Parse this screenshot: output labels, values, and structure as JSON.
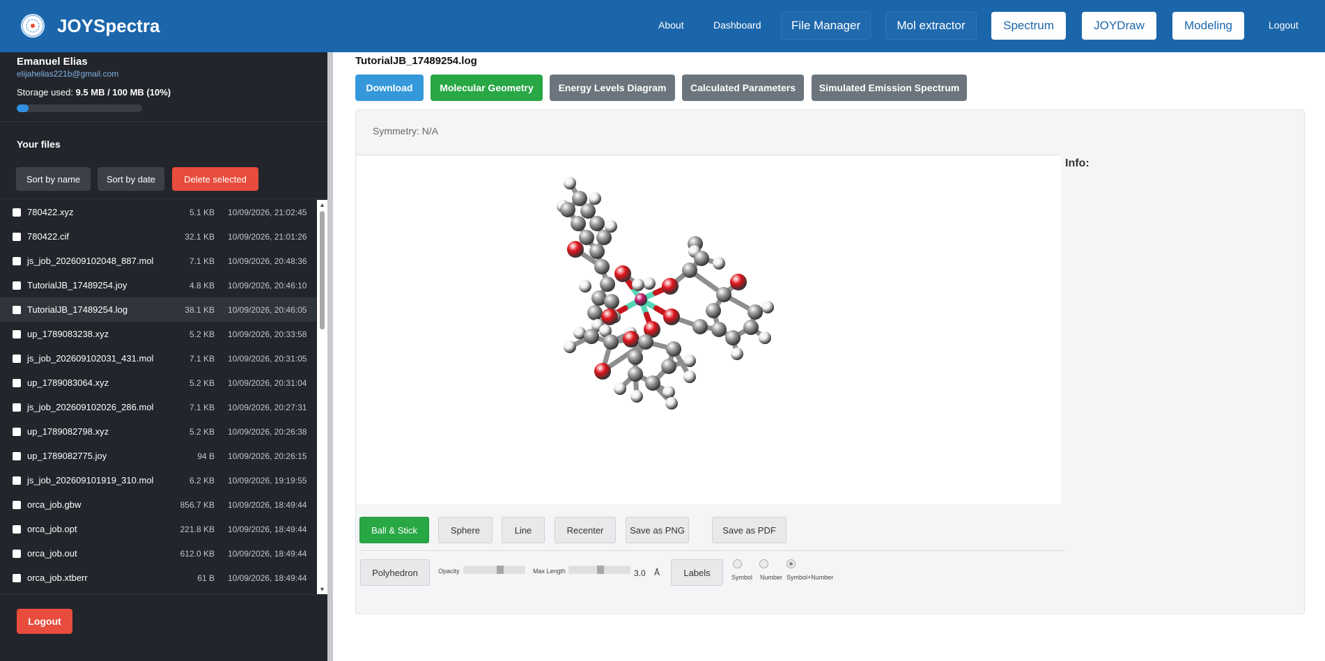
{
  "brand": {
    "name": "JOYSpectra",
    "logo_icon": "logo-icon"
  },
  "nav": {
    "about": "About",
    "dashboard": "Dashboard",
    "file_manager": "File Manager",
    "mol_extractor": "Mol extractor",
    "spectrum": "Spectrum",
    "joydraw": "JOYDraw",
    "modeling": "Modeling",
    "logout": "Logout"
  },
  "user": {
    "name": "Emanuel Elias",
    "email": "elijahelias221b@gmail.com",
    "storage_label": "Storage used: ",
    "storage_value": "9.5 MB / 100 MB (10%)",
    "storage_fraction": 0.095
  },
  "files": {
    "title": "Your files",
    "sort_by_name": "Sort by name",
    "sort_by_date": "Sort by date",
    "delete_selected": "Delete selected",
    "items": [
      {
        "name": "780422.xyz",
        "size": "5.1 KB",
        "date": "10/09/2026, 21:02:45"
      },
      {
        "name": "780422.cif",
        "size": "32.1 KB",
        "date": "10/09/2026, 21:01:26"
      },
      {
        "name": "js_job_202609102048_887.mol",
        "size": "7.1 KB",
        "date": "10/09/2026, 20:48:36"
      },
      {
        "name": "TutorialJB_17489254.joy",
        "size": "4.8 KB",
        "date": "10/09/2026, 20:46:10"
      },
      {
        "name": "TutorialJB_17489254.log",
        "size": "38.1 KB",
        "date": "10/09/2026, 20:46:05"
      },
      {
        "name": "up_1789083238.xyz",
        "size": "5.2 KB",
        "date": "10/09/2026, 20:33:58"
      },
      {
        "name": "js_job_202609102031_431.mol",
        "size": "7.1 KB",
        "date": "10/09/2026, 20:31:05"
      },
      {
        "name": "up_1789083064.xyz",
        "size": "5.2 KB",
        "date": "10/09/2026, 20:31:04"
      },
      {
        "name": "js_job_202609102026_286.mol",
        "size": "7.1 KB",
        "date": "10/09/2026, 20:27:31"
      },
      {
        "name": "up_1789082798.xyz",
        "size": "5.2 KB",
        "date": "10/09/2026, 20:26:38"
      },
      {
        "name": "up_1789082775.joy",
        "size": "94 B",
        "date": "10/09/2026, 20:26:15"
      },
      {
        "name": "js_job_202609101919_310.mol",
        "size": "6.2 KB",
        "date": "10/09/2026, 19:19:55"
      },
      {
        "name": "orca_job.gbw",
        "size": "856.7 KB",
        "date": "10/09/2026, 18:49:44"
      },
      {
        "name": "orca_job.opt",
        "size": "221.8 KB",
        "date": "10/09/2026, 18:49:44"
      },
      {
        "name": "orca_job.out",
        "size": "612.0 KB",
        "date": "10/09/2026, 18:49:44"
      },
      {
        "name": "orca_job.xtberr",
        "size": "61 B",
        "date": "10/09/2026, 18:49:44"
      }
    ],
    "selected_index": 4
  },
  "sidebar_logout": "Logout",
  "main": {
    "title": "TutorialJB_17489254.log",
    "tabs": {
      "download": "Download",
      "molecular_geometry": "Molecular Geometry",
      "energy_levels": "Energy Levels Diagram",
      "calculated_parameters": "Calculated Parameters",
      "emission_spectrum": "Simulated Emission Spectrum"
    },
    "symmetry": "Symmetry: N/A",
    "info": "Info:"
  },
  "viewer_controls": {
    "ball_stick": "Ball & Stick",
    "sphere": "Sphere",
    "line": "Line",
    "recenter": "Recenter",
    "save_png": "Save as PNG",
    "save_pdf": "Save as PDF",
    "polyhedron": "Polyhedron",
    "opacity_label": "Opacity",
    "opacity_fraction": 0.6,
    "max_length_label": "Max Length",
    "max_length_value": "3.0",
    "max_length_unit": "Å",
    "max_length_fraction": 0.5,
    "labels": "Labels",
    "label_symbol": "Symbol",
    "label_number": "Number",
    "label_symbol_number": "Symbol+Number",
    "label_mode": "Symbol+Number"
  },
  "colors": {
    "nav_bg": "#1b66ab",
    "sidebar_bg": "#22252b",
    "download": "#3498db",
    "success": "#28a745",
    "secondary": "#6c757d",
    "danger": "#e74c3c",
    "carbon": "#9a9a9a",
    "oxygen": "#e0121b",
    "hydrogen": "#eeeeee",
    "metal": "#c2196b",
    "bond_metal": "#56d6b6"
  }
}
